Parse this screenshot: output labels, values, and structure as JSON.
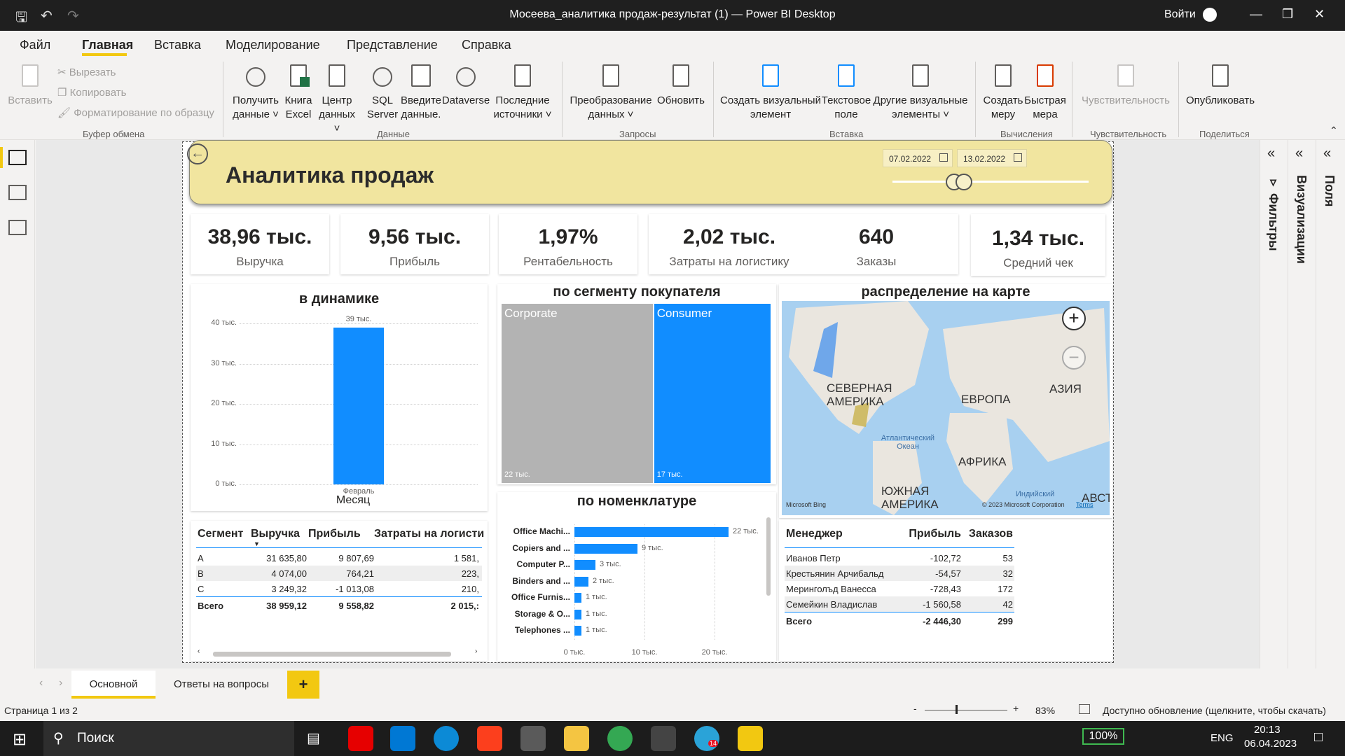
{
  "window": {
    "title": "Мосеева_аналитика продаж-результат (1) — Power BI Desktop",
    "signin": "Войти"
  },
  "menu": [
    "Файл",
    "Главная",
    "Вставка",
    "Моделирование",
    "Представление",
    "Справка"
  ],
  "ribbon": {
    "clipboard": {
      "paste": "Вставить",
      "cut": "Вырезать",
      "copy": "Копировать",
      "format": "Форматирование по образцу",
      "group": "Буфер обмена"
    },
    "data": {
      "get_data": "Получить данные",
      "excel": "Книга Excel",
      "hub": "Центр данных",
      "sql": "SQL Server",
      "enter": "Введите данные.",
      "dataverse": "Dataverse",
      "recent": "Последние источники",
      "group": "Данные"
    },
    "queries": {
      "transform": "Преобразование данных",
      "refresh": "Обновить",
      "group": "Запросы"
    },
    "insert": {
      "new_visual": "Создать визуальный элемент",
      "textbox": "Текстовое поле",
      "more": "Другие визуальные элементы",
      "group": "Вставка"
    },
    "calc": {
      "new_measure": "Создать меру",
      "quick_measure": "Быстрая мера",
      "group": "Вычисления"
    },
    "sensitivity": {
      "label": "Чувствительность",
      "group": "Чувствительность"
    },
    "share": {
      "publish": "Опубликовать",
      "group": "Поделиться"
    }
  },
  "report": {
    "title": "Аналитика продаж",
    "date_from": "07.02.2022",
    "date_to": "13.02.2022"
  },
  "kpis": {
    "revenue": {
      "value": "38,96 тыс.",
      "label": "Выручка"
    },
    "profit": {
      "value": "9,56 тыс.",
      "label": "Прибыль"
    },
    "margin": {
      "value": "1,97%",
      "label": "Рентабельность"
    },
    "logistics": {
      "value": "2,02 тыс.",
      "label": "Затраты на логистику"
    },
    "orders": {
      "value": "640",
      "label": "Заказы"
    },
    "avg_check": {
      "value": "1,34 тыс.",
      "label": "Средний чек"
    }
  },
  "chart_data": [
    {
      "type": "bar",
      "title": "в динамике",
      "xlabel": "Месяц",
      "categories": [
        "Февраль"
      ],
      "values": [
        39000
      ],
      "data_labels": [
        "39 тыс."
      ],
      "yticks": [
        "0 тыс.",
        "10 тыс.",
        "20 тыс.",
        "30 тыс.",
        "40 тыс."
      ],
      "ylim": [
        0,
        40000
      ],
      "color": "#118dff"
    },
    {
      "type": "treemap",
      "title": "по сегменту покупателя",
      "categories": [
        "Corporate",
        "Consumer"
      ],
      "values": [
        22000,
        17000
      ],
      "data_labels": [
        "22 тыс.",
        "17 тыс."
      ],
      "colors": [
        "#b3b3b3",
        "#118dff"
      ]
    },
    {
      "type": "bar",
      "orientation": "horizontal",
      "title": "по номенклатуре",
      "categories": [
        "Office Machi...",
        "Copiers and ...",
        "Computer P...",
        "Binders and ...",
        "Office Furnis...",
        "Storage & O...",
        "Telephones ..."
      ],
      "values": [
        22000,
        9000,
        3000,
        2000,
        1000,
        1000,
        1000
      ],
      "data_labels": [
        "22 тыс.",
        "9 тыс.",
        "3 тыс.",
        "2 тыс.",
        "1 тыс.",
        "1 тыс.",
        "1 тыс."
      ],
      "xticks": [
        "0 тыс.",
        "10 тыс.",
        "20 тыс."
      ],
      "xlim": [
        0,
        23000
      ],
      "color": "#118dff"
    }
  ],
  "map": {
    "title": "распределение на карте",
    "labels": [
      "СЕВЕРНАЯ АМЕРИКА",
      "ЕВРОПА",
      "АЗИЯ",
      "Атлантический Океан",
      "АФРИКА",
      "ЮЖНАЯ АМЕРИКА",
      "Индийский",
      "АВСТР"
    ],
    "bing": "Microsoft Bing",
    "copyright": "© 2023 Microsoft Corporation",
    "terms": "Terms"
  },
  "segment_table": {
    "headers": [
      "Сегмент",
      "Выручка",
      "Прибыль",
      "Затраты на логисти"
    ],
    "rows": [
      [
        "A",
        "31 635,80",
        "9 807,69",
        "1 581,"
      ],
      [
        "B",
        "4 074,00",
        "764,21",
        "223,"
      ],
      [
        "C",
        "3 249,32",
        "-1 013,08",
        "210,"
      ]
    ],
    "total": [
      "Всего",
      "38 959,12",
      "9 558,82",
      "2 015,:"
    ]
  },
  "manager_table": {
    "headers": [
      "Менеджер",
      "Прибыль",
      "Заказов"
    ],
    "rows": [
      [
        "Иванов Петр",
        "-102,72",
        "53"
      ],
      [
        "Крестьянин Арчибальд",
        "-54,57",
        "32"
      ],
      [
        "Меринголъд Ванесса",
        "-728,43",
        "172"
      ],
      [
        "Семейкин Владислав",
        "-1 560,58",
        "42"
      ]
    ],
    "total": [
      "Всего",
      "-2 446,30",
      "299"
    ]
  },
  "panes": {
    "filters": "Фильтры",
    "visualizations": "Визуализации",
    "fields": "Поля"
  },
  "page_tabs": [
    "Основной",
    "Ответы на вопросы"
  ],
  "status": {
    "page": "Страница 1 из 2",
    "zoom": "83%",
    "update": "Доступно обновление (щелкните, чтобы скачать)"
  },
  "taskbar": {
    "search": "Поиск",
    "battery": "100%",
    "lang": "ENG",
    "time": "20:13",
    "date": "06.04.2023",
    "badge": "14"
  }
}
